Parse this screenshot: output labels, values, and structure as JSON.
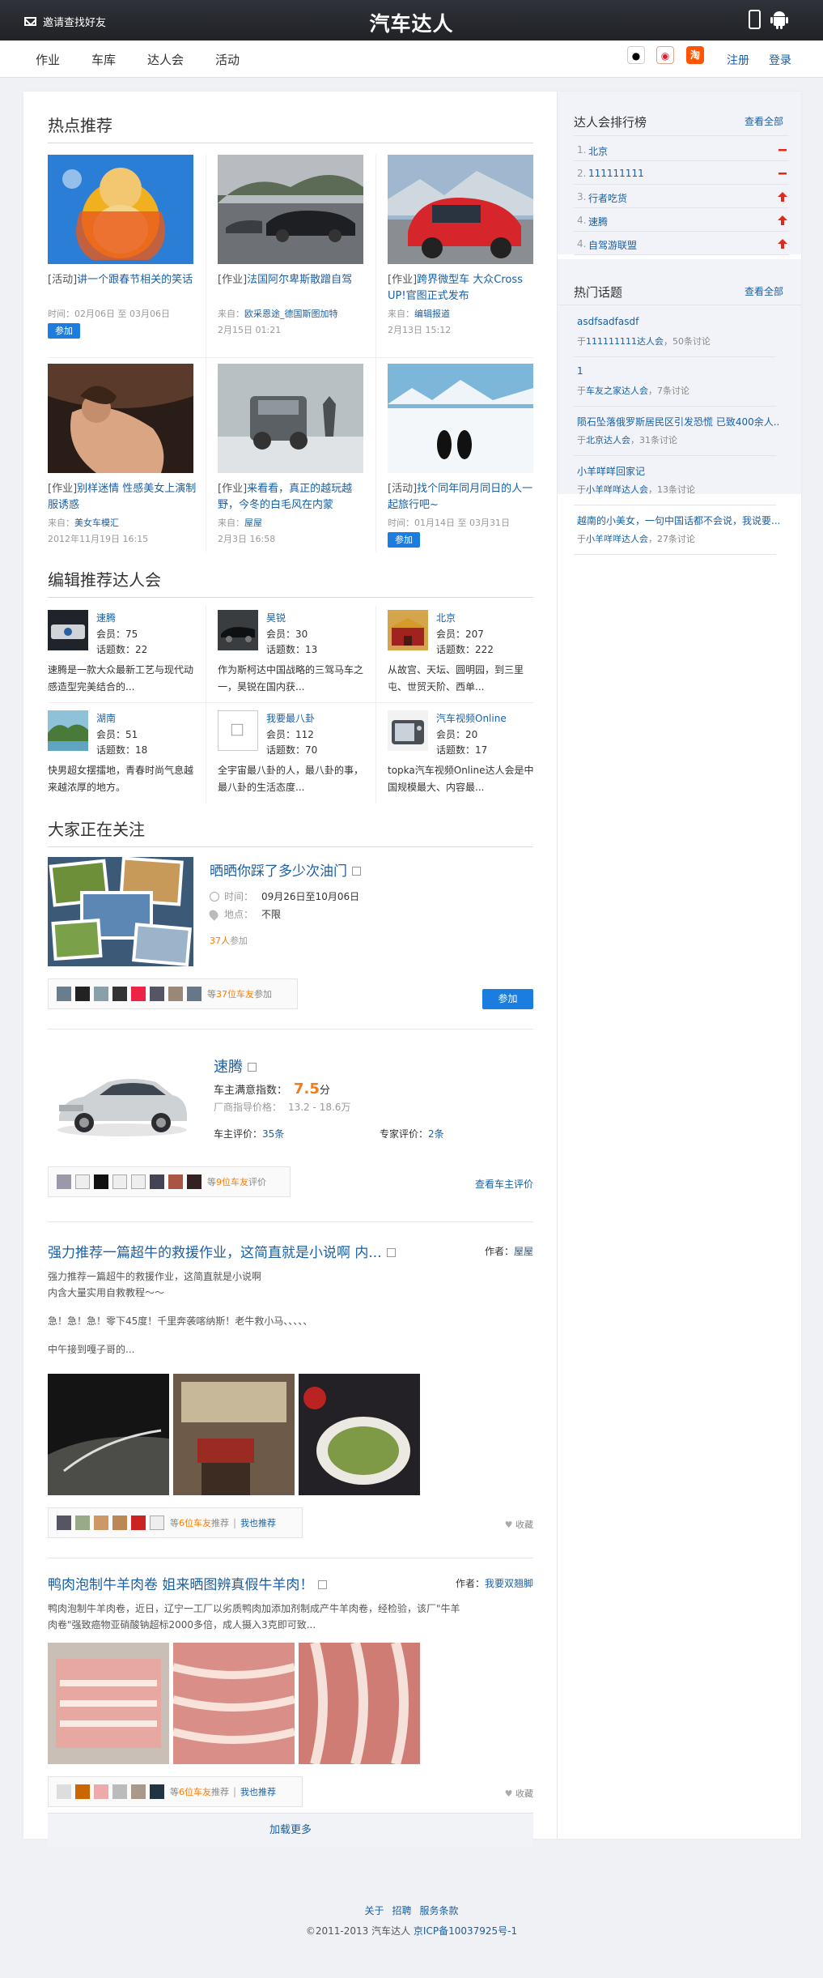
{
  "header": {
    "invite": "邀请查找好友",
    "logo": "汽车达人"
  },
  "nav": {
    "items": [
      "作业",
      "车库",
      "达人会",
      "活动"
    ],
    "register": "注册",
    "login": "登录",
    "weibo_label": "淘"
  },
  "hot": {
    "title": "热点推荐",
    "cards": [
      {
        "tag": "[活动]",
        "title": "讲一个跟春节相关的笑话",
        "meta1": "时间：02月06日 至 03月06日",
        "button": "参加"
      },
      {
        "tag": "[作业]",
        "title": "法国阿尔卑斯散蹭自驾",
        "meta1_pre": "来自：",
        "meta1_link": "欧采恩途_德国斯图加特",
        "meta2": "2月15日 01:21"
      },
      {
        "tag": "[作业]",
        "title": "跨界微型车 大众Cross UP!官图正式发布",
        "meta1_pre": "来自：",
        "meta1_link": "编辑报道",
        "meta2": "2月13日 15:12"
      },
      {
        "tag": "[作业]",
        "title": "别样迷情 性感美女上演制服诱惑",
        "meta1_pre": "来自：",
        "meta1_link": "美女车模汇",
        "meta2": "2012年11月19日 16:15"
      },
      {
        "tag": "[作业]",
        "title": "来看看，真正的越玩越野，今冬的白毛风在内蒙",
        "meta1_pre": "来自：",
        "meta1_link": "屋屋",
        "meta2": "2月3日 16:58"
      },
      {
        "tag": "[活动]",
        "title": "找个同年同月同日的人一起旅行吧~",
        "meta1": "时间：01月14日 至 03月31日",
        "button": "参加"
      }
    ]
  },
  "clubs": {
    "title": "编辑推荐达人会",
    "items": [
      {
        "name": "速腾",
        "members": "会员：75",
        "topics": "话题数：22",
        "desc": "速腾是一款大众最新工艺与现代动感造型完美结合的..."
      },
      {
        "name": "昊锐",
        "members": "会员：30",
        "topics": "话题数：13",
        "desc": "作为斯柯达中国战略的三驾马车之一，昊锐在国内获..."
      },
      {
        "name": "北京",
        "members": "会员：207",
        "topics": "话题数：222",
        "desc": "从故宫、天坛、圆明园，到三里屯、世贸天阶、西单..."
      },
      {
        "name": "湖南",
        "members": "会员：51",
        "topics": "话题数：18",
        "desc": "快男超女摆擂地，青春时尚气息越来越浓厚的地方。"
      },
      {
        "name": "我要最八卦",
        "members": "会员：112",
        "topics": "话题数：70",
        "desc": "全宇宙最八卦的人，最八卦的事，最八卦的生活态度..."
      },
      {
        "name": "汽车视频Online",
        "members": "会员：20",
        "topics": "话题数：17",
        "desc": "topka汽车视频Online达人会是中国规模最大、内容最..."
      }
    ]
  },
  "follow": {
    "title": "大家正在关注",
    "event": {
      "title": "晒晒你踩了多少次油门",
      "time_label": "时间：",
      "time": "09月26日至10月06日",
      "place_label": "地点：",
      "place": "不限",
      "count": "37人",
      "count_suffix": "参加",
      "likers_pre": "等",
      "likers_num": "37位车友",
      "likers_suf": "参加",
      "button": "参加"
    },
    "car": {
      "title": "速腾",
      "score_label": "车主满意指数：",
      "score": "7.5",
      "score_unit": "分",
      "price_label": "厂商指导价格：",
      "price": "13.2 - 18.6万",
      "owner_label": "车主评价：",
      "owner": "35条",
      "expert_label": "专家评价：",
      "expert": "2条",
      "likers_pre": "等",
      "likers_num": "9位车友",
      "likers_suf": "评价",
      "all": "查看车主评价"
    },
    "post1": {
      "title": "强力推荐一篇超牛的救援作业，这简直就是小说啊 内...",
      "author_label": "作者：",
      "author": "屋屋",
      "line1": "强力推荐一篇超牛的救援作业，这简直就是小说啊",
      "line2": "内含大量实用自救教程～～",
      "line3": "急！急！急！零下45度！千里奔袭喀纳斯！老牛救小马、、、、、",
      "line4": "中午接到嘎子哥的...",
      "likers_pre": "等",
      "likers_num": "6位车友",
      "likers_suf": "推荐",
      "me_too": "我也推荐",
      "collect": "收藏"
    },
    "post2": {
      "title": "鸭肉泡制牛羊肉卷 姐来晒图辨真假牛羊肉！",
      "author_label": "作者：",
      "author": "我要双翘脚",
      "line1": "鸭肉泡制牛羊肉卷，近日，辽宁一工厂以劣质鸭肉加添加剂制成产牛羊肉卷，经检验，该厂\"牛羊",
      "line2": "肉卷\"强致癌物亚硝酸钠超标2000多倍，成人摄入3克即可致...",
      "likers_pre": "等",
      "likers_num": "6位车友",
      "likers_suf": "推荐",
      "me_too": "我也推荐",
      "collect": "收藏"
    },
    "load_more": "加载更多"
  },
  "ranking": {
    "title": "达人会排行榜",
    "all": "查看全部",
    "items": [
      {
        "num": "1.",
        "name": "北京",
        "trend": "same"
      },
      {
        "num": "2.",
        "name": "111111111",
        "trend": "same"
      },
      {
        "num": "3.",
        "name": "行者吃货",
        "trend": "up"
      },
      {
        "num": "4.",
        "name": "速腾",
        "trend": "up"
      },
      {
        "num": "4.",
        "name": "自驾游联盟",
        "trend": "up"
      }
    ]
  },
  "topics": {
    "title": "热门话题",
    "all": "查看全部",
    "items": [
      {
        "title": "asdfsadfasdf",
        "pre": "于",
        "club": "111111111达人会",
        "post": "，50条讨论"
      },
      {
        "title": "1",
        "pre": "于",
        "club": "车友之家达人会",
        "post": "，7条讨论"
      },
      {
        "title": "陨石坠落俄罗斯居民区引发恐慌 已致400余人...",
        "pre": "于",
        "club": "北京达人会",
        "post": "，31条讨论"
      },
      {
        "title": "小羊咩咩回家记",
        "pre": "于",
        "club": "小羊咩咩达人会",
        "post": "，13条讨论"
      },
      {
        "title": "越南的小美女，一句中国话都不会说，我说要...",
        "pre": "于",
        "club": "小羊咩咩达人会",
        "post": "，27条讨论"
      }
    ]
  },
  "footer": {
    "links": [
      "关于",
      "招聘",
      "服务条款"
    ],
    "copyright": "©2011-2013 汽车达人",
    "icp": "京ICP备10037925号-1"
  },
  "colors": {
    "link": "#1a5fa3",
    "accent": "#1b7de0",
    "orange": "#ff7a00",
    "score": "#f07c1a"
  }
}
